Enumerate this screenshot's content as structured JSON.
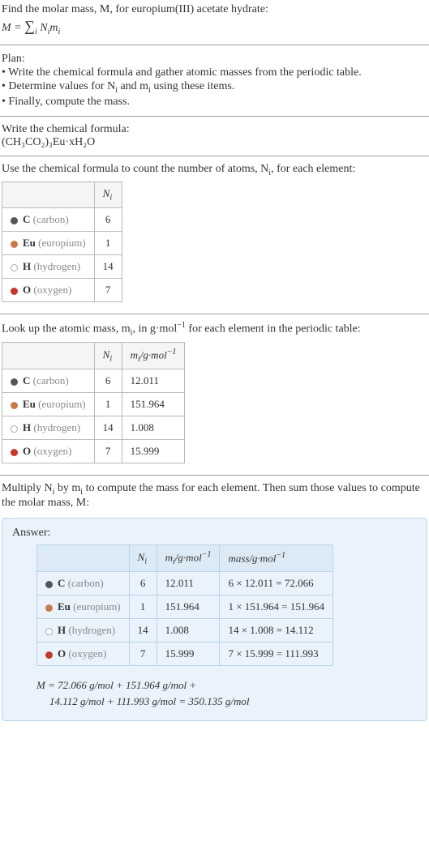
{
  "intro": {
    "line1": "Find the molar mass, M, for europium(III) acetate hydrate:",
    "eq_lhs": "M = ",
    "eq_sigma": "∑",
    "eq_sub": "i",
    "eq_rhs": " N",
    "eq_rhs2": "m",
    "eq_i": "i"
  },
  "plan": {
    "title": "Plan:",
    "b1": "• Write the chemical formula and gather atomic masses from the periodic table.",
    "b2_a": "• Determine values for N",
    "b2_b": " and m",
    "b2_c": " using these items.",
    "b3": "• Finally, compute the mass."
  },
  "formula": {
    "title": "Write the chemical formula:",
    "text": "(CH₃CO₂)₃Eu·xH₂O"
  },
  "count": {
    "title_a": "Use the chemical formula to count the number of atoms, N",
    "title_b": ", for each element:",
    "header_ni": "N",
    "rows": [
      {
        "sym": "C",
        "name": "(carbon)",
        "dot": "dot-c",
        "n": "6"
      },
      {
        "sym": "Eu",
        "name": "(europium)",
        "dot": "dot-eu",
        "n": "1"
      },
      {
        "sym": "H",
        "name": "(hydrogen)",
        "dot": "dot-h",
        "n": "14"
      },
      {
        "sym": "O",
        "name": "(oxygen)",
        "dot": "dot-o",
        "n": "7"
      }
    ]
  },
  "lookup": {
    "title_a": "Look up the atomic mass, m",
    "title_b": ", in g·mol",
    "title_c": " for each element in the periodic table:",
    "header_ni": "N",
    "header_mi_a": "m",
    "header_mi_b": "/g·mol",
    "neg1": "−1",
    "rows": [
      {
        "sym": "C",
        "name": "(carbon)",
        "dot": "dot-c",
        "n": "6",
        "m": "12.011"
      },
      {
        "sym": "Eu",
        "name": "(europium)",
        "dot": "dot-eu",
        "n": "1",
        "m": "151.964"
      },
      {
        "sym": "H",
        "name": "(hydrogen)",
        "dot": "dot-h",
        "n": "14",
        "m": "1.008"
      },
      {
        "sym": "O",
        "name": "(oxygen)",
        "dot": "dot-o",
        "n": "7",
        "m": "15.999"
      }
    ]
  },
  "multiply": {
    "text_a": "Multiply N",
    "text_b": " by m",
    "text_c": " to compute the mass for each element. Then sum those values to compute the molar mass, M:"
  },
  "answer": {
    "label": "Answer:",
    "header_ni": "N",
    "header_mi_a": "m",
    "header_mi_b": "/g·mol",
    "header_mass": "mass/g·mol",
    "neg1": "−1",
    "i": "i",
    "rows": [
      {
        "sym": "C",
        "name": "(carbon)",
        "dot": "dot-c",
        "n": "6",
        "m": "12.011",
        "calc": "6 × 12.011 = 72.066"
      },
      {
        "sym": "Eu",
        "name": "(europium)",
        "dot": "dot-eu",
        "n": "1",
        "m": "151.964",
        "calc": "1 × 151.964 = 151.964"
      },
      {
        "sym": "H",
        "name": "(hydrogen)",
        "dot": "dot-h",
        "n": "14",
        "m": "1.008",
        "calc": "14 × 1.008 = 14.112"
      },
      {
        "sym": "O",
        "name": "(oxygen)",
        "dot": "dot-o",
        "n": "7",
        "m": "15.999",
        "calc": "7 × 15.999 = 111.993"
      }
    ],
    "final1": "M = 72.066 g/mol + 151.964 g/mol +",
    "final2": "14.112 g/mol + 111.993 g/mol = 350.135 g/mol"
  }
}
